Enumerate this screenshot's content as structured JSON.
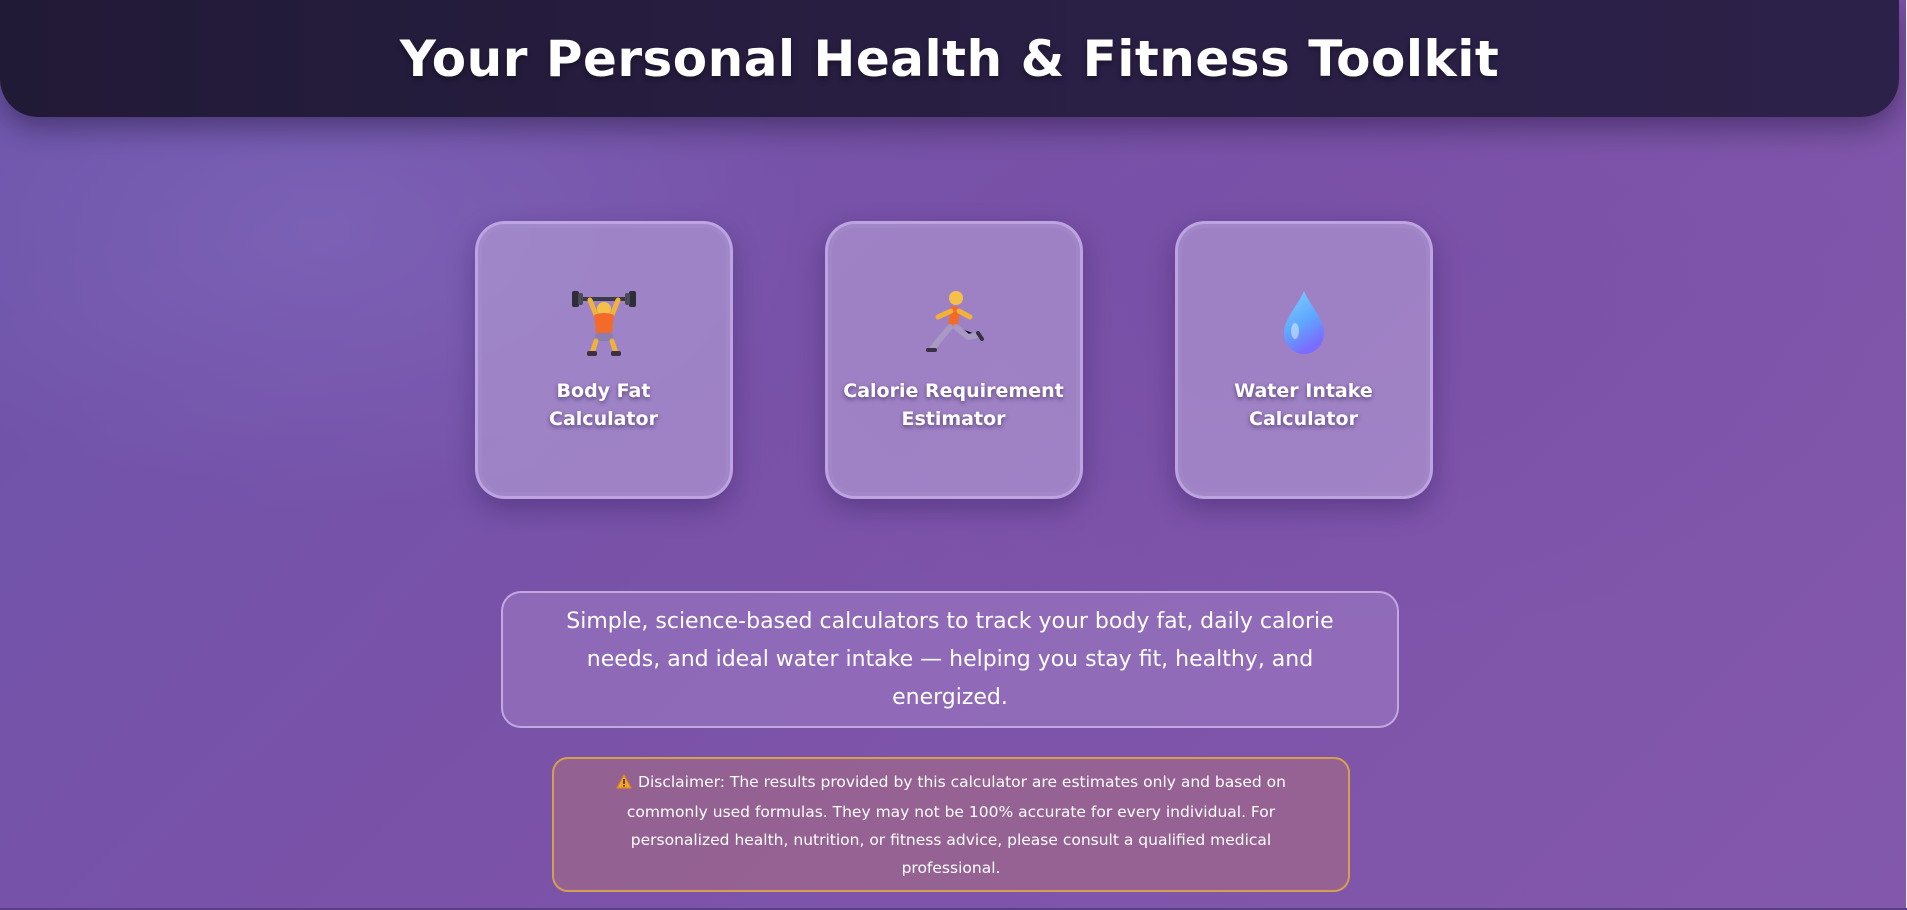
{
  "header": {
    "title": "Your Personal Health & Fitness Toolkit"
  },
  "cards": [
    {
      "label": "Body Fat\nCalculator",
      "icon": "weightlifter-icon"
    },
    {
      "label": "Calorie Requirement\nEstimator",
      "icon": "runner-icon"
    },
    {
      "label": "Water Intake\nCalculator",
      "icon": "water-drop-icon"
    }
  ],
  "intro": {
    "text": "Simple, science-based calculators to track your body fat, daily calorie needs, and ideal water intake — helping you stay fit, healthy, and energized."
  },
  "disclaimer": {
    "icon": "warning-icon",
    "text": "Disclaimer: The results provided by this calculator are estimates only and based on commonly used formulas. They may not be 100% accurate for every individual. For personalized health, nutrition, or fitness advice, please consult a qualified medical professional."
  },
  "colors": {
    "header_bg": "#221b38",
    "page_gradient_start": "#6c55ab",
    "page_gradient_end": "#8358ac",
    "disclaimer_border": "#d4a050",
    "water_drop": "#6fb2ff"
  }
}
